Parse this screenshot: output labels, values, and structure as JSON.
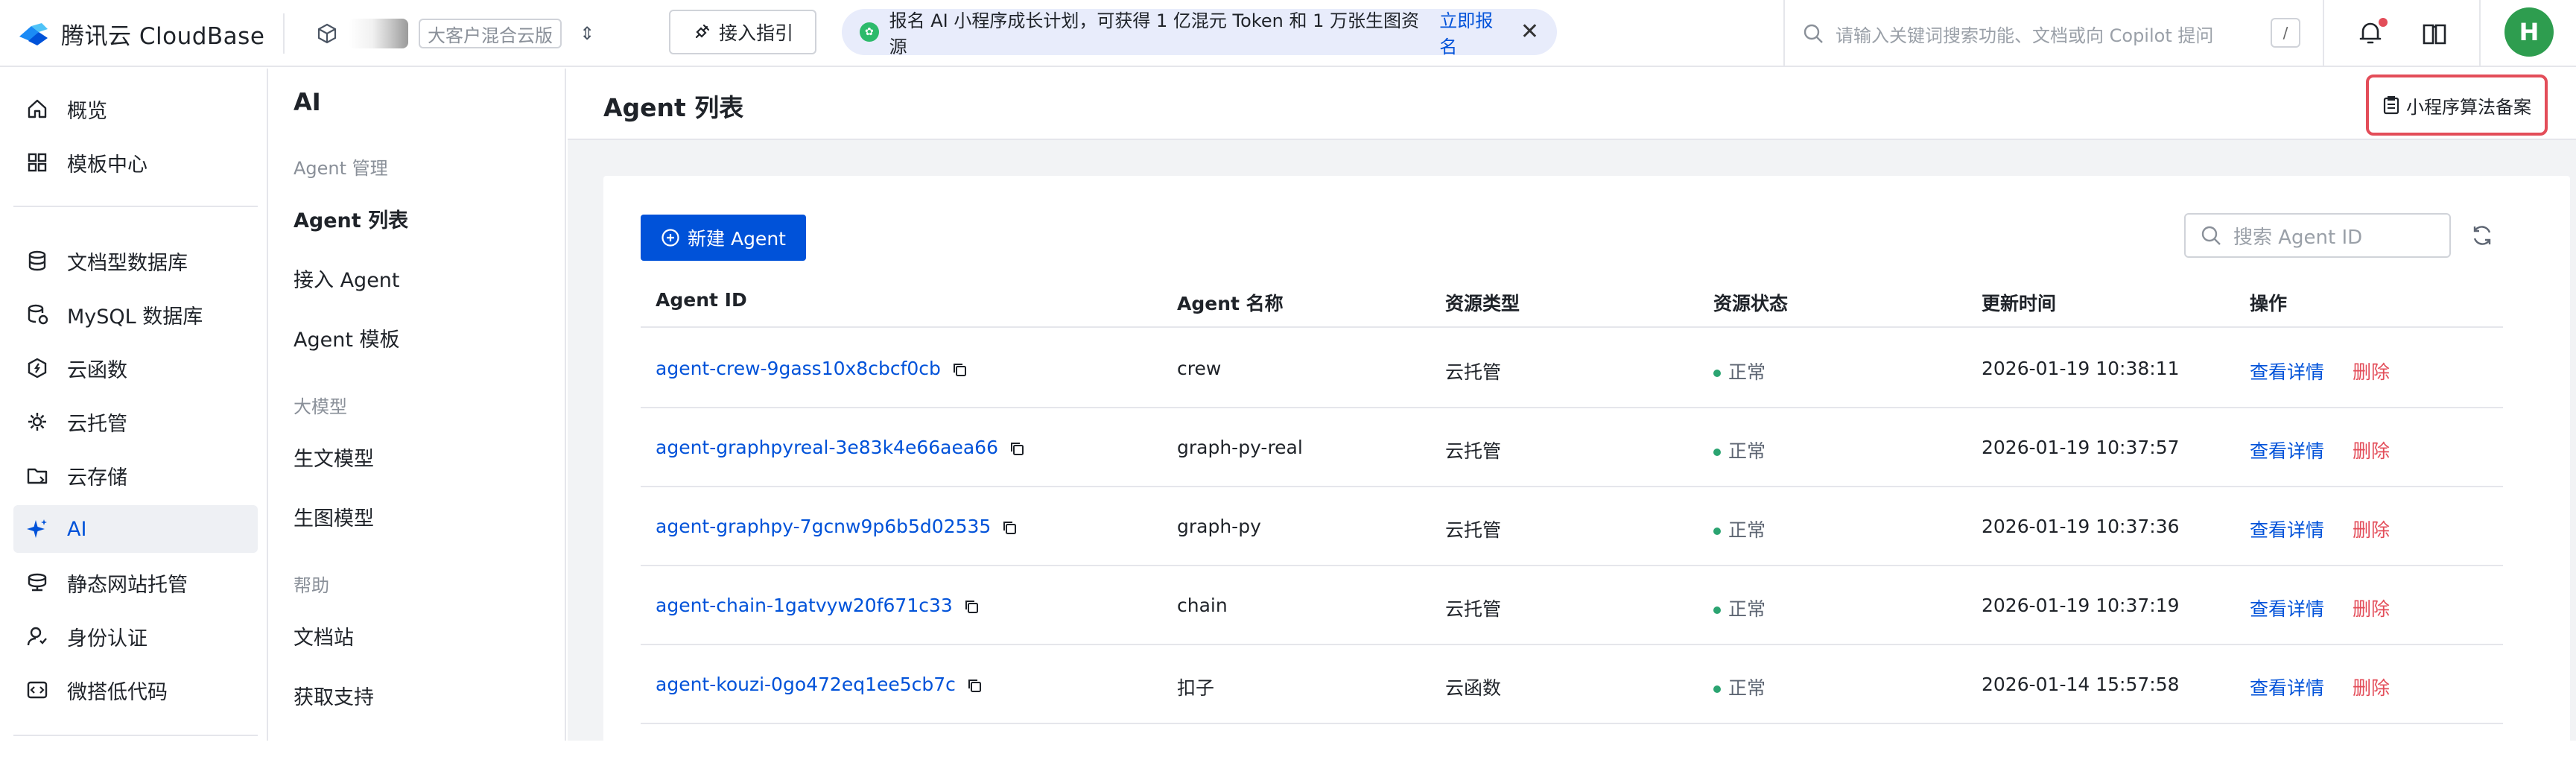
{
  "topbar": {
    "brand": "腾讯云 CloudBase",
    "env_label": "大客户混合云版",
    "guide_button": "接入指引",
    "banner_text": "报名 AI 小程序成长计划，可获得 1 亿混元 Token 和 1 万张生图资源",
    "banner_link": "立即报名",
    "search_placeholder": "请输入关键词搜索功能、文档或向 Copilot 提问",
    "search_shortcut": "/",
    "avatar_initial": "H"
  },
  "sidebar": {
    "items": [
      {
        "label": "概览",
        "icon": "home-icon"
      },
      {
        "label": "模板中心",
        "icon": "template-grid-icon"
      },
      {
        "label": "文档型数据库",
        "icon": "database-icon"
      },
      {
        "label": "MySQL 数据库",
        "icon": "mysql-database-icon"
      },
      {
        "label": "云函数",
        "icon": "function-icon"
      },
      {
        "label": "云托管",
        "icon": "cloud-hosting-icon"
      },
      {
        "label": "云存储",
        "icon": "storage-icon"
      },
      {
        "label": "AI",
        "icon": "ai-sparkle-icon"
      },
      {
        "label": "静态网站托管",
        "icon": "static-site-icon"
      },
      {
        "label": "身份认证",
        "icon": "identity-icon"
      },
      {
        "label": "微搭低代码",
        "icon": "lowcode-icon"
      }
    ],
    "active": "AI"
  },
  "subnav": {
    "title": "AI",
    "group_agent": "Agent 管理",
    "agent_list": "Agent 列表",
    "agent_connect": "接入 Agent",
    "agent_template": "Agent 模板",
    "group_model": "大模型",
    "text_model": "生文模型",
    "image_model": "生图模型",
    "group_help": "帮助",
    "docs": "文档站",
    "support": "获取支持"
  },
  "main": {
    "page_title": "Agent 列表",
    "record_button": "小程序算法备案",
    "new_button": "新建 Agent",
    "search_placeholder": "搜索 Agent ID",
    "columns": [
      "Agent ID",
      "Agent 名称",
      "资源类型",
      "资源状态",
      "更新时间",
      "操作"
    ],
    "view_label": "查看详情",
    "delete_label": "删除",
    "rows": [
      {
        "id": "agent-crew-9gass10x8cbcf0cb",
        "name": "crew",
        "type": "云托管",
        "status": "正常",
        "updated": "2026-01-19 10:38:11"
      },
      {
        "id": "agent-graphpyreal-3e83k4e66aea66",
        "name": "graph-py-real",
        "type": "云托管",
        "status": "正常",
        "updated": "2026-01-19 10:37:57"
      },
      {
        "id": "agent-graphpy-7gcnw9p6b5d02535",
        "name": "graph-py",
        "type": "云托管",
        "status": "正常",
        "updated": "2026-01-19 10:37:36"
      },
      {
        "id": "agent-chain-1gatvyw20f671c33",
        "name": "chain",
        "type": "云托管",
        "status": "正常",
        "updated": "2026-01-19 10:37:19"
      },
      {
        "id": "agent-kouzi-0go472eq1ee5cb7c",
        "name": "扣子",
        "type": "云函数",
        "status": "正常",
        "updated": "2026-01-14 15:57:58"
      }
    ]
  },
  "colors": {
    "primary": "#0052d9",
    "danger": "#e34d59",
    "success": "#2ba471",
    "banner_bg": "#e8ecfb"
  }
}
